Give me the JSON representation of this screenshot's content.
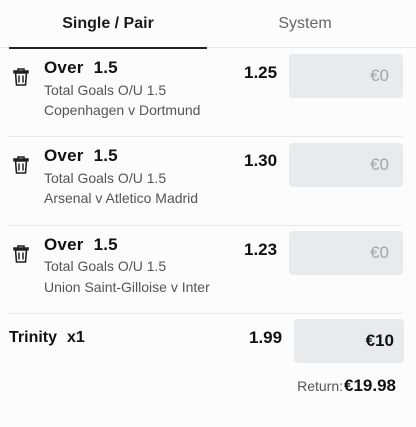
{
  "tabs": {
    "single_pair": "Single / Pair",
    "system": "System"
  },
  "bets": [
    {
      "selection": "Over",
      "line": "1.5",
      "market": "Total Goals O/U 1.5",
      "event": "Copenhagen v Dortmund",
      "odds": "1.25",
      "stake_placeholder": "€0"
    },
    {
      "selection": "Over",
      "line": "1.5",
      "market": "Total Goals O/U 1.5",
      "event": "Arsenal v Atletico Madrid",
      "odds": "1.30",
      "stake_placeholder": "€0"
    },
    {
      "selection": "Over",
      "line": "1.5",
      "market": "Total Goals O/U 1.5",
      "event": "Union Saint-Gilloise v Inter",
      "odds": "1.23",
      "stake_placeholder": "€0"
    }
  ],
  "system": {
    "name": "Trinity",
    "multiplier": "x1",
    "odds": "1.99",
    "stake": "€10"
  },
  "return": {
    "label": "Return:",
    "amount": "€19.98"
  },
  "icons": {
    "remove": "trash-icon"
  },
  "colors": {
    "input_bg": "#e9eaeb",
    "active_tab_underline": "#222222",
    "placeholder": "#a5a5a5"
  }
}
